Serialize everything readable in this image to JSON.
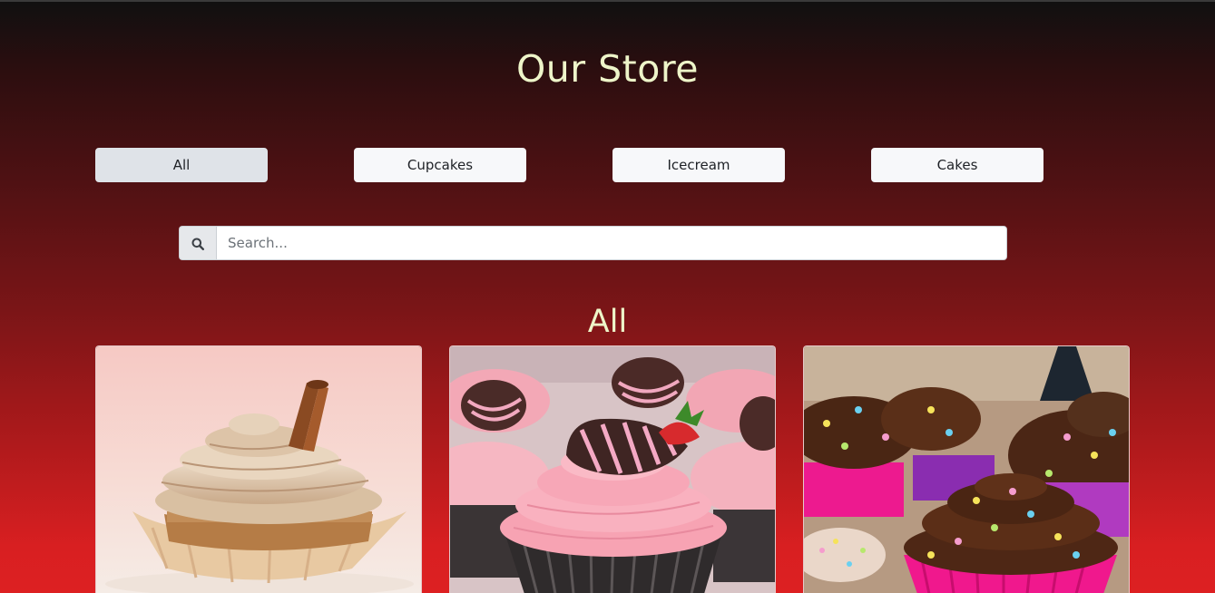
{
  "header": {
    "title": "Our Store"
  },
  "filters": [
    {
      "label": "All",
      "active": true
    },
    {
      "label": "Cupcakes",
      "active": false
    },
    {
      "label": "Icecream",
      "active": false
    },
    {
      "label": "Cakes",
      "active": false
    }
  ],
  "search": {
    "placeholder": "Search...",
    "value": "",
    "icon": "search-icon"
  },
  "section": {
    "title": "All"
  },
  "products": [
    {
      "image": "cinnamon-cupcake-photo"
    },
    {
      "image": "strawberry-cupcake-photo"
    },
    {
      "image": "chocolate-sprinkle-cupcake-photo"
    }
  ],
  "colors": {
    "title_text": "#eef5c9",
    "background_top": "#101010",
    "background_bottom": "#dd2022",
    "button_bg": "#f7f8fa",
    "button_active_bg": "#dfe3e8"
  }
}
